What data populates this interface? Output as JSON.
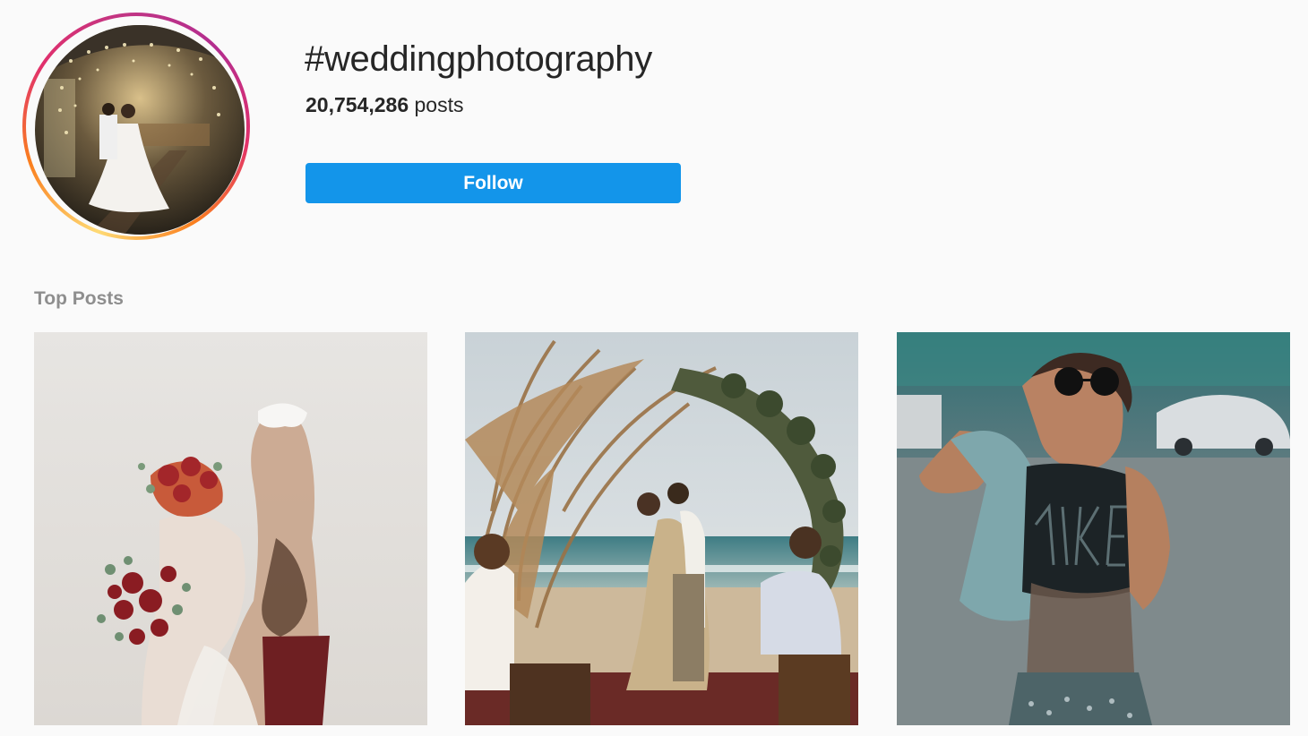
{
  "hashtag": {
    "name": "#weddingphotography",
    "post_count": "20,754,286",
    "posts_label": "posts"
  },
  "actions": {
    "follow_label": "Follow"
  },
  "sections": {
    "top_posts_label": "Top Posts"
  },
  "posts": [
    {
      "subject": "double-exposure-bride-groom-bouquet"
    },
    {
      "subject": "beach-ceremony-kiss-under-floral-arch"
    },
    {
      "subject": "woman-sunglasses-mesh-top-street"
    }
  ],
  "colors": {
    "follow_button": "#1395ea",
    "background": "#fafafa",
    "muted_text": "#8e8e8e"
  }
}
